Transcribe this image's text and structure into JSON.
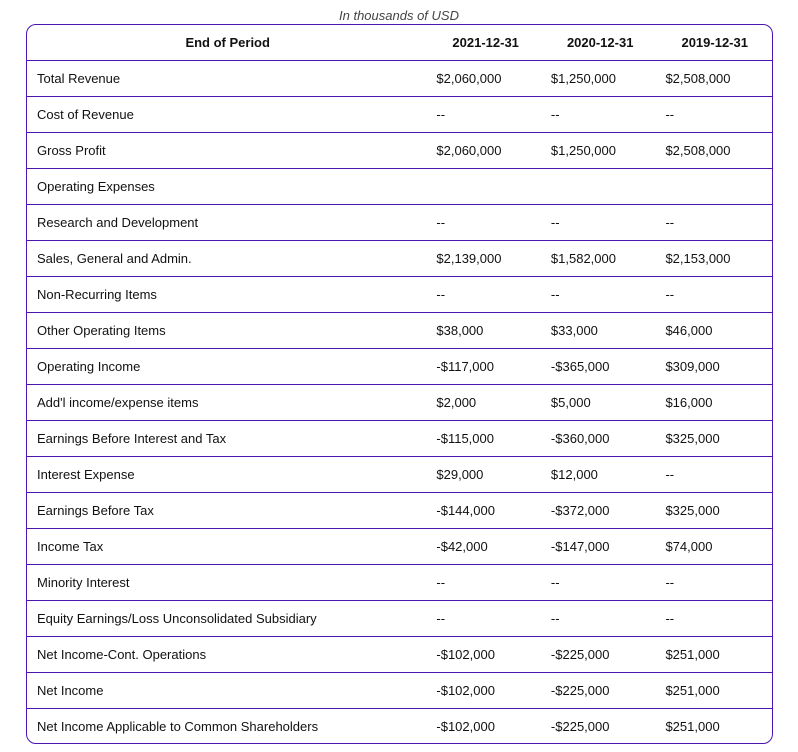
{
  "caption": "In thousands of USD",
  "table": {
    "header": {
      "label": "End of Period",
      "periods": [
        "2021-12-31",
        "2020-12-31",
        "2019-12-31"
      ]
    },
    "rows": [
      {
        "label": "Total Revenue",
        "values": [
          "$2,060,000",
          "$1,250,000",
          "$2,508,000"
        ]
      },
      {
        "label": "Cost of Revenue",
        "values": [
          "--",
          "--",
          "--"
        ]
      },
      {
        "label": "Gross Profit",
        "values": [
          "$2,060,000",
          "$1,250,000",
          "$2,508,000"
        ]
      },
      {
        "label": "Operating Expenses",
        "values": [
          "",
          "",
          ""
        ]
      },
      {
        "label": "Research and Development",
        "values": [
          "--",
          "--",
          "--"
        ]
      },
      {
        "label": "Sales, General and Admin.",
        "values": [
          "$2,139,000",
          "$1,582,000",
          "$2,153,000"
        ]
      },
      {
        "label": "Non-Recurring Items",
        "values": [
          "--",
          "--",
          "--"
        ]
      },
      {
        "label": "Other Operating Items",
        "values": [
          "$38,000",
          "$33,000",
          "$46,000"
        ]
      },
      {
        "label": "Operating Income",
        "values": [
          "-$117,000",
          "-$365,000",
          "$309,000"
        ]
      },
      {
        "label": "Add'l income/expense items",
        "values": [
          "$2,000",
          "$5,000",
          "$16,000"
        ]
      },
      {
        "label": "Earnings Before Interest and Tax",
        "values": [
          "-$115,000",
          "-$360,000",
          "$325,000"
        ]
      },
      {
        "label": "Interest Expense",
        "values": [
          "$29,000",
          "$12,000",
          "--"
        ]
      },
      {
        "label": "Earnings Before Tax",
        "values": [
          "-$144,000",
          "-$372,000",
          "$325,000"
        ]
      },
      {
        "label": "Income Tax",
        "values": [
          "-$42,000",
          "-$147,000",
          "$74,000"
        ]
      },
      {
        "label": "Minority Interest",
        "values": [
          "--",
          "--",
          "--"
        ]
      },
      {
        "label": "Equity Earnings/Loss Unconsolidated Subsidiary",
        "values": [
          "--",
          "--",
          "--"
        ]
      },
      {
        "label": "Net Income-Cont. Operations",
        "values": [
          "-$102,000",
          "-$225,000",
          "$251,000"
        ]
      },
      {
        "label": "Net Income",
        "values": [
          "-$102,000",
          "-$225,000",
          "$251,000"
        ]
      },
      {
        "label": "Net Income Applicable to Common Shareholders",
        "values": [
          "-$102,000",
          "-$225,000",
          "$251,000"
        ]
      }
    ]
  },
  "colors": {
    "border": "#4b16b3",
    "caption": "#444444",
    "text": "#111111"
  }
}
